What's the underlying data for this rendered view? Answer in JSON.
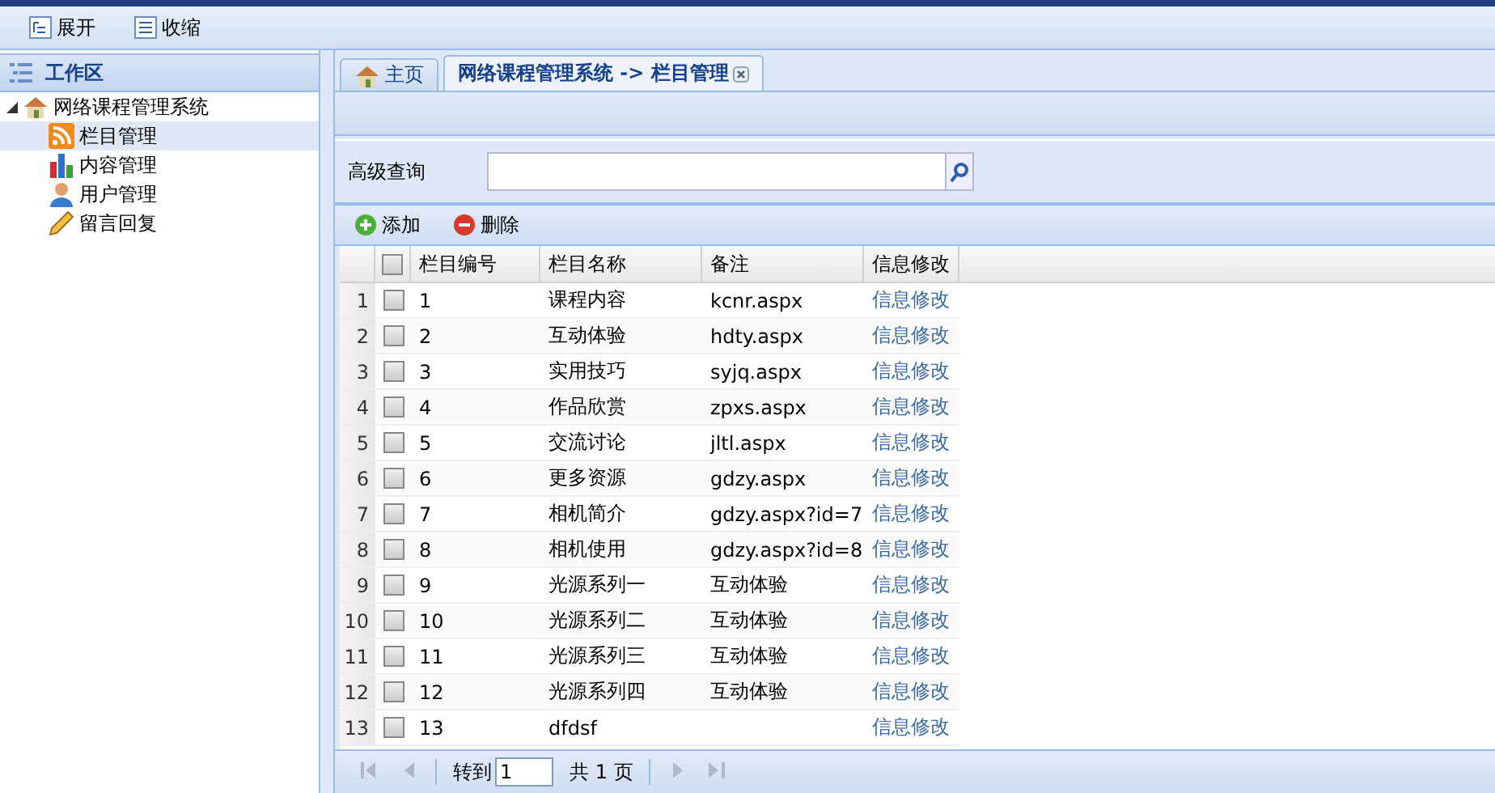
{
  "toolbar": [
    {
      "label": "展开",
      "kind": "expand"
    },
    {
      "label": "收缩",
      "kind": "collapse"
    }
  ],
  "sidebar": {
    "title": "工作区",
    "tree": [
      {
        "label": "网络课程管理系统",
        "kind": "home",
        "expanded": true,
        "selected": false,
        "children": [
          {
            "label": "栏目管理",
            "kind": "rss",
            "selected": true
          },
          {
            "label": "内容管理",
            "kind": "chart",
            "selected": false
          },
          {
            "label": "用户管理",
            "kind": "user",
            "selected": false
          },
          {
            "label": "留言回复",
            "kind": "pencil",
            "selected": false
          }
        ]
      }
    ]
  },
  "tabs": [
    {
      "label": "主页",
      "kind": "home",
      "selected": false,
      "closable": false
    },
    {
      "label": "网络课程管理系统 -> 栏目管理",
      "kind": "plain",
      "selected": true,
      "closable": true
    }
  ],
  "search": {
    "label": "高级查询"
  },
  "actions": [
    {
      "label": "添加",
      "kind": "add"
    },
    {
      "label": "删除",
      "kind": "delete"
    }
  ],
  "table": {
    "header_checked": false,
    "columns": [
      "栏目编号",
      "栏目名称",
      "备注",
      "信息修改"
    ],
    "rows": [
      {
        "index": "1",
        "checked": false,
        "cells": [
          "1",
          "课程内容",
          "kcnr.aspx"
        ],
        "action": "信息修改"
      },
      {
        "index": "2",
        "checked": false,
        "cells": [
          "2",
          "互动体验",
          "hdty.aspx"
        ],
        "action": "信息修改"
      },
      {
        "index": "3",
        "checked": false,
        "cells": [
          "3",
          "实用技巧",
          "syjq.aspx"
        ],
        "action": "信息修改"
      },
      {
        "index": "4",
        "checked": false,
        "cells": [
          "4",
          "作品欣赏",
          "zpxs.aspx"
        ],
        "action": "信息修改"
      },
      {
        "index": "5",
        "checked": false,
        "cells": [
          "5",
          "交流讨论",
          "jltl.aspx"
        ],
        "action": "信息修改"
      },
      {
        "index": "6",
        "checked": false,
        "cells": [
          "6",
          "更多资源",
          "gdzy.aspx"
        ],
        "action": "信息修改"
      },
      {
        "index": "7",
        "checked": false,
        "cells": [
          "7",
          "相机简介",
          "gdzy.aspx?id=7"
        ],
        "action": "信息修改"
      },
      {
        "index": "8",
        "checked": false,
        "cells": [
          "8",
          "相机使用",
          "gdzy.aspx?id=8"
        ],
        "action": "信息修改"
      },
      {
        "index": "9",
        "checked": false,
        "cells": [
          "9",
          "光源系列一",
          "互动体验"
        ],
        "action": "信息修改"
      },
      {
        "index": "10",
        "checked": false,
        "cells": [
          "10",
          "光源系列二",
          "互动体验"
        ],
        "action": "信息修改"
      },
      {
        "index": "11",
        "checked": false,
        "cells": [
          "11",
          "光源系列三",
          "互动体验"
        ],
        "action": "信息修改"
      },
      {
        "index": "12",
        "checked": false,
        "cells": [
          "12",
          "光源系列四",
          "互动体验"
        ],
        "action": "信息修改"
      },
      {
        "index": "13",
        "checked": false,
        "cells": [
          "13",
          "dfdsf",
          ""
        ],
        "action": "信息修改"
      }
    ]
  },
  "pager": {
    "goto_label": "转到",
    "page": "1",
    "total_label": "共 1 页"
  }
}
